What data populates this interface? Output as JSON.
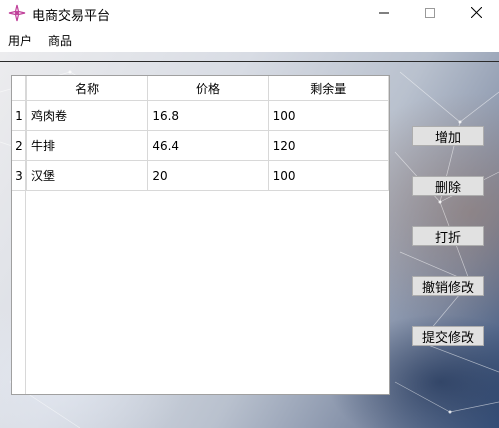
{
  "window": {
    "title": "电商交易平台"
  },
  "menu": {
    "items": [
      "用户",
      "商品"
    ]
  },
  "table": {
    "columns": [
      "名称",
      "价格",
      "剩余量"
    ],
    "rows": [
      {
        "index": "1",
        "name": "鸡肉卷",
        "price": "16.8",
        "stock": "100"
      },
      {
        "index": "2",
        "name": "牛排",
        "price": "46.4",
        "stock": "120"
      },
      {
        "index": "3",
        "name": "汉堡",
        "price": "20",
        "stock": "100"
      }
    ]
  },
  "actions": {
    "add": "增加",
    "delete": "删除",
    "discount": "打折",
    "undo": "撤销修改",
    "submit": "提交修改"
  },
  "icons": {
    "app": "compass-star-icon",
    "minimize": "minimize-icon",
    "maximize": "maximize-icon",
    "close": "close-icon"
  },
  "colors": {
    "app_icon": "#c0409a",
    "button_bg": "#e1e1e1",
    "grid_line": "#d8d8d8"
  }
}
